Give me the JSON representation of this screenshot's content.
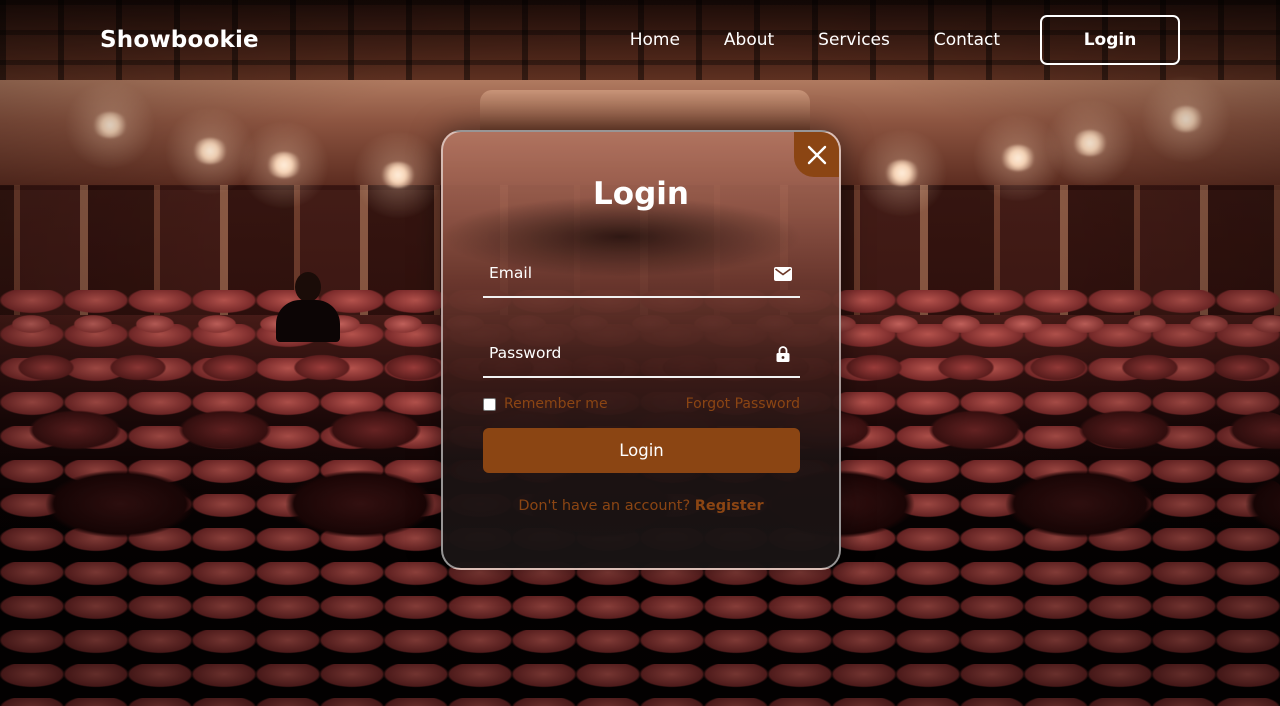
{
  "header": {
    "logo": "Showbookie",
    "nav": [
      "Home",
      "About",
      "Services",
      "Contact"
    ],
    "login_button": "Login"
  },
  "modal": {
    "title": "Login",
    "email": {
      "label": "Email",
      "icon": "mail-icon",
      "value": ""
    },
    "password": {
      "label": "Password",
      "icon": "lock-icon",
      "value": ""
    },
    "remember": {
      "label": "Remember me",
      "checked": false
    },
    "forgot": "Forgot Password",
    "submit": "Login",
    "register_prompt": "Don't have an account?",
    "register_link": "Register",
    "close_icon": "close-icon"
  },
  "colors": {
    "accent": "#8b4513",
    "text": "#ffffff"
  }
}
